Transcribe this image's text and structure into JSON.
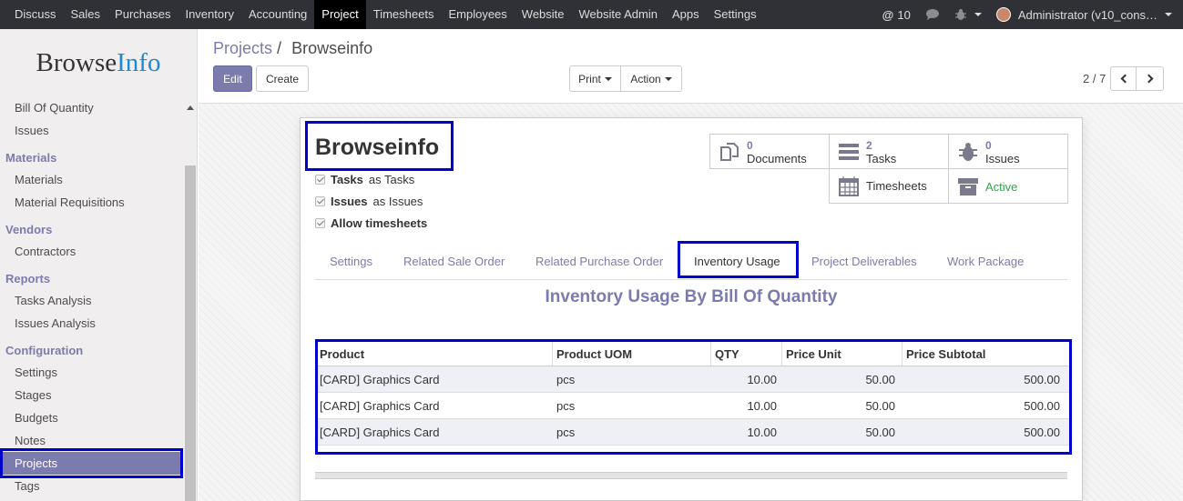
{
  "topnav": {
    "menu": [
      "Discuss",
      "Sales",
      "Purchases",
      "Inventory",
      "Accounting",
      "Project",
      "Timesheets",
      "Employees",
      "Website",
      "Website Admin",
      "Apps",
      "Settings"
    ],
    "active": "Project",
    "messages_count": "10",
    "user": "Administrator (v10_cons…"
  },
  "sidebar": {
    "logo_a": "Browse",
    "logo_b": "Info",
    "items": [
      {
        "type": "item",
        "label": "Bill Of Quantity"
      },
      {
        "type": "item",
        "label": "Issues"
      },
      {
        "type": "header",
        "label": "Materials"
      },
      {
        "type": "item",
        "label": "Materials"
      },
      {
        "type": "item",
        "label": "Material Requisitions"
      },
      {
        "type": "header",
        "label": "Vendors"
      },
      {
        "type": "item",
        "label": "Contractors"
      },
      {
        "type": "header",
        "label": "Reports"
      },
      {
        "type": "item",
        "label": "Tasks Analysis"
      },
      {
        "type": "item",
        "label": "Issues Analysis"
      },
      {
        "type": "header",
        "label": "Configuration"
      },
      {
        "type": "item",
        "label": "Settings"
      },
      {
        "type": "item",
        "label": "Stages"
      },
      {
        "type": "item",
        "label": "Budgets"
      },
      {
        "type": "item",
        "label": "Notes"
      },
      {
        "type": "item",
        "label": "Projects",
        "active": true
      },
      {
        "type": "item",
        "label": "Tags"
      }
    ]
  },
  "breadcrumb": {
    "parent": "Projects",
    "sep": "/",
    "current": "Browseinfo"
  },
  "buttons": {
    "edit": "Edit",
    "create": "Create",
    "print": "Print",
    "action": "Action"
  },
  "pager": {
    "label": "2 / 7"
  },
  "record": {
    "name": "Browseinfo",
    "checks": [
      {
        "label": "Tasks",
        "suffix": "as Tasks"
      },
      {
        "label": "Issues",
        "suffix": "as Issues"
      },
      {
        "label": "Allow timesheets",
        "suffix": ""
      }
    ]
  },
  "stats": {
    "documents": {
      "count": "0",
      "label": "Documents"
    },
    "tasks": {
      "count": "2",
      "label": "Tasks"
    },
    "issues": {
      "count": "0",
      "label": "Issues"
    },
    "timesheets": {
      "label": "Timesheets"
    },
    "active": {
      "label": "Active"
    }
  },
  "tabs": [
    "Settings",
    "Related Sale Order",
    "Related Purchase Order",
    "Inventory Usage",
    "Project Deliverables",
    "Work Package"
  ],
  "active_tab": "Inventory Usage",
  "section_title": "Inventory Usage By Bill Of Quantity",
  "table": {
    "columns": [
      "Product",
      "Product UOM",
      "QTY",
      "Price Unit",
      "Price Subtotal"
    ],
    "rows": [
      [
        "[CARD] Graphics Card",
        "pcs",
        "10.00",
        "50.00",
        "500.00"
      ],
      [
        "[CARD] Graphics Card",
        "pcs",
        "10.00",
        "50.00",
        "500.00"
      ],
      [
        "[CARD] Graphics Card",
        "pcs",
        "10.00",
        "50.00",
        "500.00"
      ]
    ]
  },
  "colors": {
    "accent": "#7c7bad",
    "highlight": "#0000cc",
    "active_green": "#28a745"
  }
}
